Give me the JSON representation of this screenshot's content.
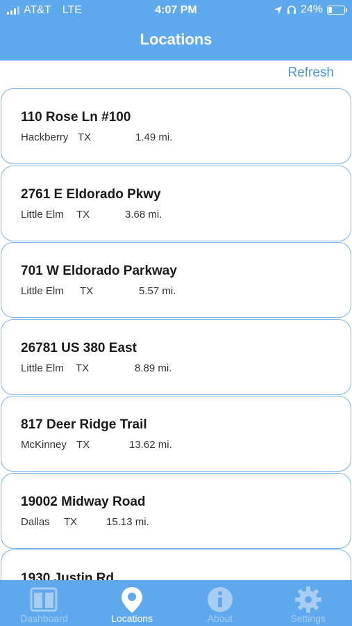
{
  "status_bar": {
    "carrier": "AT&T",
    "network": "LTE",
    "time": "4:07 PM",
    "battery_percent": "24%",
    "battery_level": 0.24
  },
  "header": {
    "title": "Locations"
  },
  "toolbar": {
    "refresh_label": "Refresh"
  },
  "locations": [
    {
      "address": "110 Rose Ln #100",
      "city": "Hackberry",
      "state": "TX",
      "distance": "1.49 mi."
    },
    {
      "address": "2761 E Eldorado Pkwy",
      "city": "Little Elm",
      "state": "TX",
      "distance": "3.68 mi."
    },
    {
      "address": "701 W Eldorado Parkway",
      "city": "Little Elm",
      "state": "TX",
      "distance": "5.57 mi."
    },
    {
      "address": "26781 US 380 East",
      "city": "Little Elm",
      "state": "TX",
      "distance": "8.89 mi."
    },
    {
      "address": "817 Deer Ridge Trail",
      "city": "McKinney",
      "state": "TX",
      "distance": "13.62 mi."
    },
    {
      "address": "19002 Midway Road",
      "city": "Dallas",
      "state": "TX",
      "distance": "15.13 mi."
    },
    {
      "address": "1930 Justin Rd",
      "city": "",
      "state": "",
      "distance": ""
    }
  ],
  "tabs": [
    {
      "label": "Dashboard",
      "icon": "dashboard-icon",
      "active": false
    },
    {
      "label": "Locations",
      "icon": "location-pin-icon",
      "active": true
    },
    {
      "label": "About",
      "icon": "info-icon",
      "active": false
    },
    {
      "label": "Settings",
      "icon": "gear-icon",
      "active": false
    }
  ],
  "colors": {
    "header_bg": "#5ea8ee",
    "accent": "#4a94df",
    "card_border": "#7ab4ea",
    "tab_inactive": "#a7cdf2",
    "tab_active": "#ffffff"
  }
}
